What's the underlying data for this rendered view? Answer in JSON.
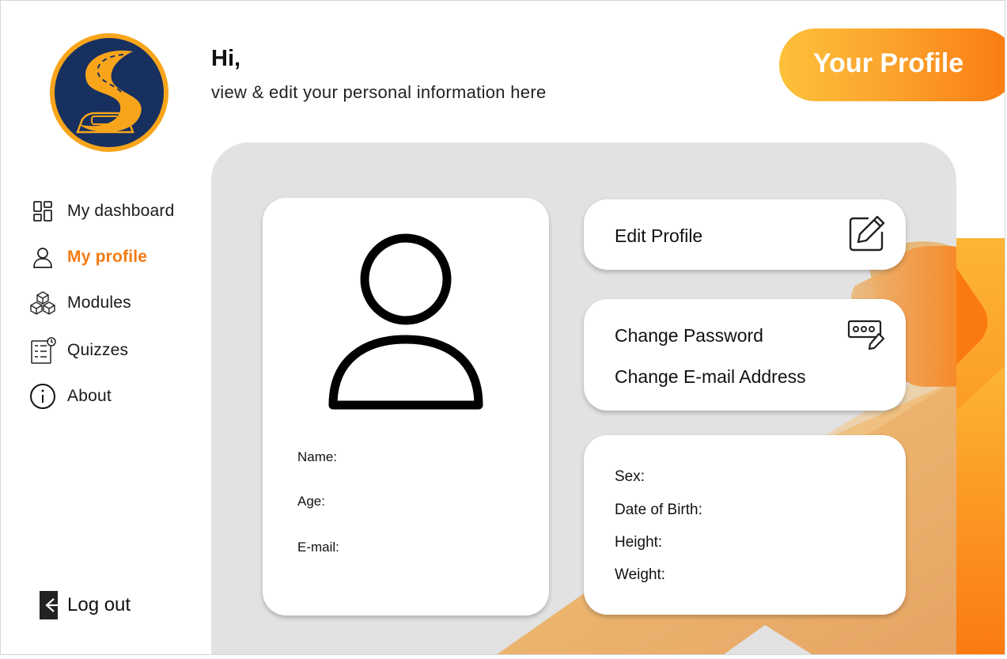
{
  "colors": {
    "accent": "#f47a12",
    "logo_navy": "#17305f",
    "logo_gold": "#f8a51b",
    "panel_gray": "#e2e2e2"
  },
  "sidebar": {
    "items": [
      {
        "label": "My dashboard",
        "icon": "dashboard-icon",
        "active": false
      },
      {
        "label": "My profile",
        "icon": "user-icon",
        "active": true
      },
      {
        "label": "Modules",
        "icon": "cubes-icon",
        "active": false
      },
      {
        "label": "Quizzes",
        "icon": "quiz-icon",
        "active": false
      },
      {
        "label": "About",
        "icon": "info-icon",
        "active": false
      }
    ],
    "logout_label": "Log out"
  },
  "header": {
    "greeting": "Hi,",
    "subtitle": "view & edit your personal information here",
    "badge": "Your Profile"
  },
  "profile_card": {
    "fields": [
      "Name:",
      "Age:",
      "E-mail:"
    ]
  },
  "actions": {
    "edit_profile": "Edit Profile",
    "change_password": "Change Password",
    "change_email": "Change E-mail Address"
  },
  "details_card": {
    "fields": [
      "Sex:",
      "Date of Birth:",
      "Height:",
      "Weight:"
    ]
  }
}
